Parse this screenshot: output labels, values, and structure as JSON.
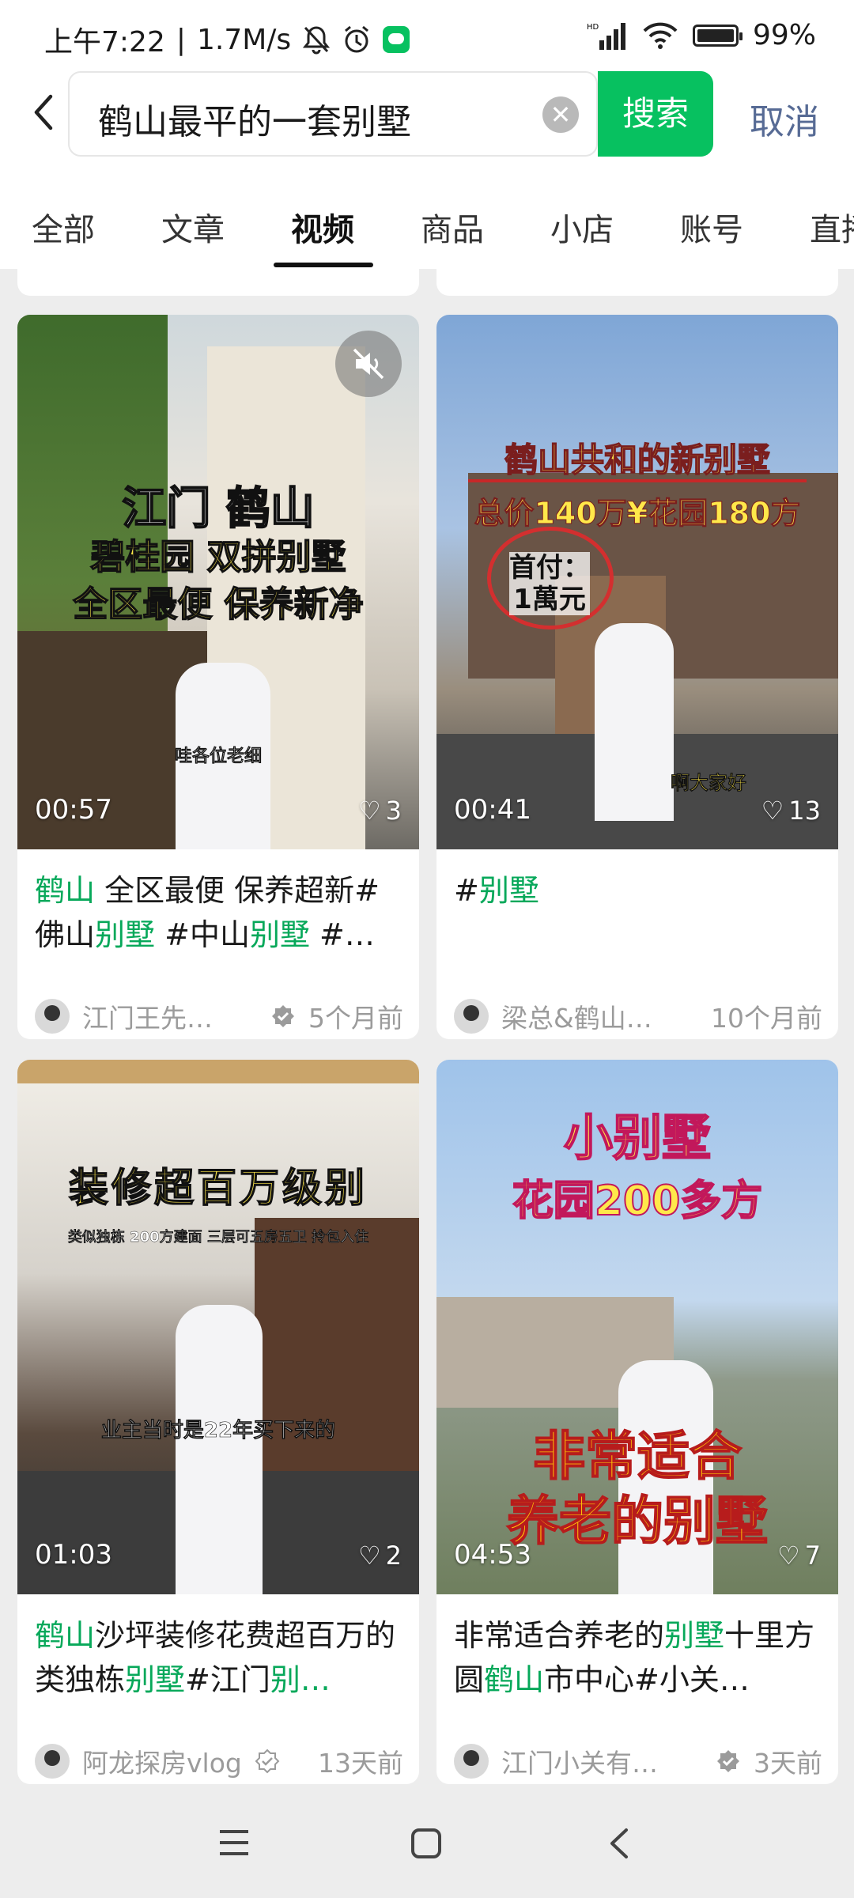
{
  "status": {
    "time": "上午7:22",
    "speed": "1.7M/s",
    "network": "HD",
    "battery": "99%"
  },
  "search": {
    "query": "鹤山最平的一套别墅",
    "button": "搜索",
    "cancel": "取消"
  },
  "tabs": [
    {
      "label": "全部"
    },
    {
      "label": "文章"
    },
    {
      "label": "视频"
    },
    {
      "label": "商品"
    },
    {
      "label": "小店"
    },
    {
      "label": "账号"
    },
    {
      "label": "直播"
    }
  ],
  "active_tab": "视频",
  "cards": [
    {
      "overlay": [
        "江门 鹤山",
        "碧桂园 双拼别墅",
        "全区最便 保养新净"
      ],
      "subtitle": "哇各位老细",
      "duration": "00:57",
      "likes": "3",
      "title": [
        {
          "t": "鹤山",
          "h": true
        },
        {
          "t": " 全区最便 保养超新#佛山",
          "h": false
        },
        {
          "t": "别墅",
          "h": true
        },
        {
          "t": " #中山",
          "h": false
        },
        {
          "t": "别墅",
          "h": true
        },
        {
          "t": " #…",
          "h": false
        }
      ],
      "author": "江门王先…",
      "time": "5个月前"
    },
    {
      "overlay": [
        "鹤山共和的新别墅",
        "总价140万¥花园180方",
        "首付：",
        "1萬元"
      ],
      "subtitle": "啊大家好",
      "duration": "00:41",
      "likes": "13",
      "title": [
        {
          "t": "#",
          "h": false
        },
        {
          "t": "别墅",
          "h": true
        }
      ],
      "author": "梁总&鹤山…",
      "time": "10个月前"
    },
    {
      "overlay": [
        "装修超百万级别",
        "类似独栋 200方建面 三层可五房五卫 拎包入住"
      ],
      "subtitle": "业主当时是22年买下来的",
      "duration": "01:03",
      "likes": "2",
      "title": [
        {
          "t": "鹤山",
          "h": true
        },
        {
          "t": "沙坪装修花费超百万的类独栋",
          "h": false
        },
        {
          "t": "别墅",
          "h": true
        },
        {
          "t": "#江门",
          "h": false
        },
        {
          "t": "别…",
          "h": true
        }
      ],
      "author": "阿龙探房vlog",
      "time": "13天前"
    },
    {
      "overlay": [
        "小别墅",
        "花园200多方",
        "非常适合",
        "养老的别墅"
      ],
      "subtitle": "",
      "duration": "04:53",
      "likes": "7",
      "title": [
        {
          "t": "非常适合养老的",
          "h": false
        },
        {
          "t": "别墅",
          "h": true
        },
        {
          "t": "十里方圆",
          "h": false
        },
        {
          "t": "鹤山",
          "h": true
        },
        {
          "t": "市中心#小关…",
          "h": false
        }
      ],
      "author": "江门小关有…",
      "time": "3天前"
    }
  ],
  "colors": {
    "accent": "#07c160",
    "highlight": "#07a85a",
    "link": "#576b95"
  }
}
